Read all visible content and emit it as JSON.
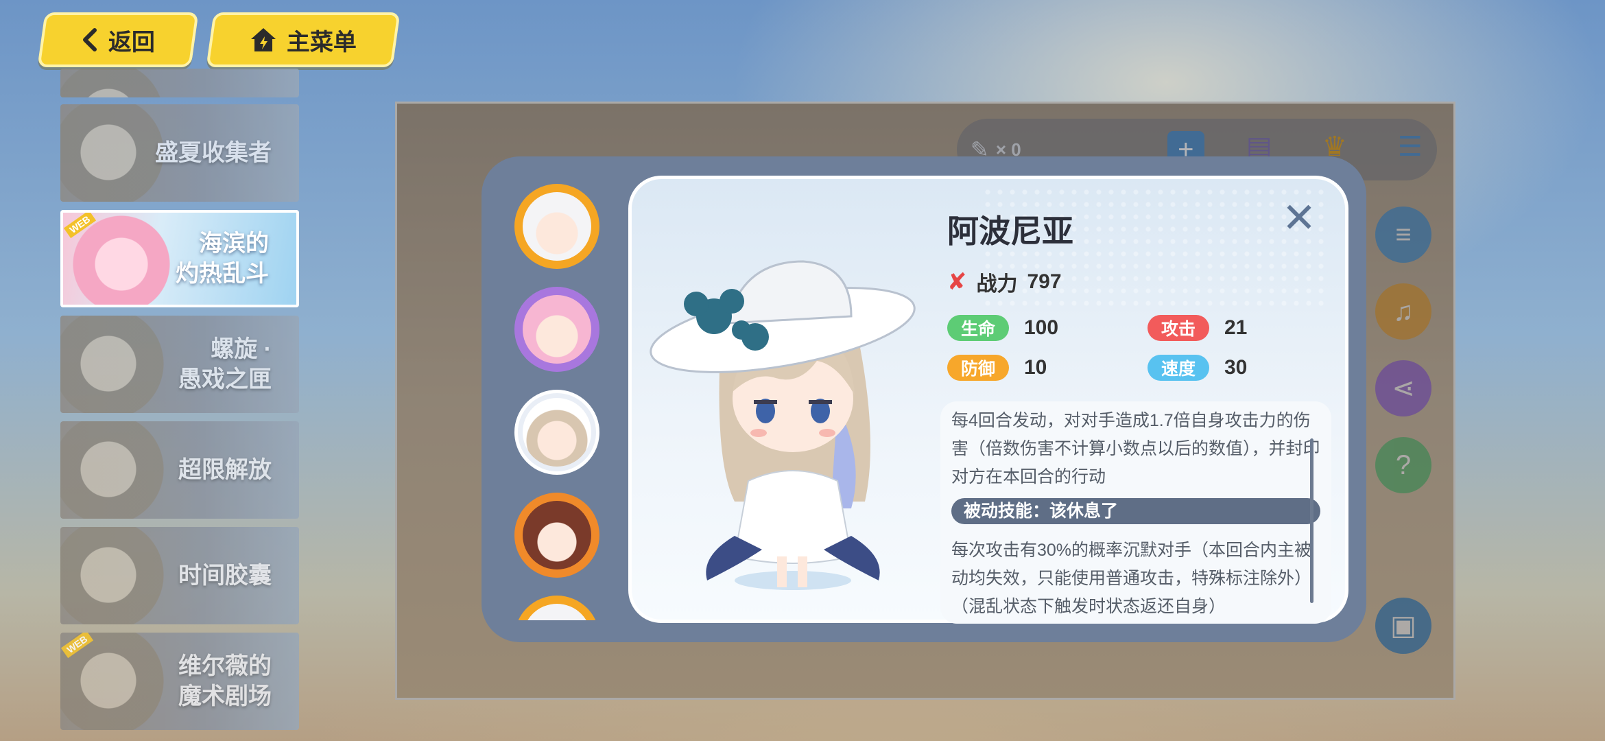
{
  "nav": {
    "back_label": "返回",
    "menu_label": "主菜单"
  },
  "events": [
    {
      "label": "盛夏收集者",
      "tag": ""
    },
    {
      "label": "海滨的\n灼热乱斗",
      "tag": "WEB"
    },
    {
      "label": "螺旋 ·\n愚戏之匣",
      "tag": ""
    },
    {
      "label": "超限解放",
      "tag": ""
    },
    {
      "label": "时间胶囊",
      "tag": ""
    },
    {
      "label": "维尔薇的\n魔术剧场",
      "tag": "WEB"
    }
  ],
  "game": {
    "currency_count": "× 0"
  },
  "character": {
    "name": "阿波尼亚",
    "power_label": "战力",
    "power_value": "797",
    "stats": {
      "hp_label": "生命",
      "hp_value": "100",
      "atk_label": "攻击",
      "atk_value": "21",
      "def_label": "防御",
      "def_value": "10",
      "spd_label": "速度",
      "spd_value": "30"
    },
    "active_skill_desc": "每4回合发动，对对手造成1.7倍自身攻击力的伤害（倍数伤害不计算小数点以后的数值），并封印对方在本回合的行动",
    "passive_skill_title": "被动技能：该休息了",
    "passive_skill_desc": "每次攻击有30%的概率沉默对手（本回合内主被动均失效，只能使用普通攻击，特殊标注除外）（混乱状态下触发时状态返还自身）"
  },
  "colors": {
    "nav_button": "#f7d22e",
    "hp_chip": "#5dcc75",
    "atk_chip": "#f25b5b",
    "def_chip": "#f7a72b",
    "spd_chip": "#58c2f0",
    "dialog_frame": "#6e7f9a"
  }
}
